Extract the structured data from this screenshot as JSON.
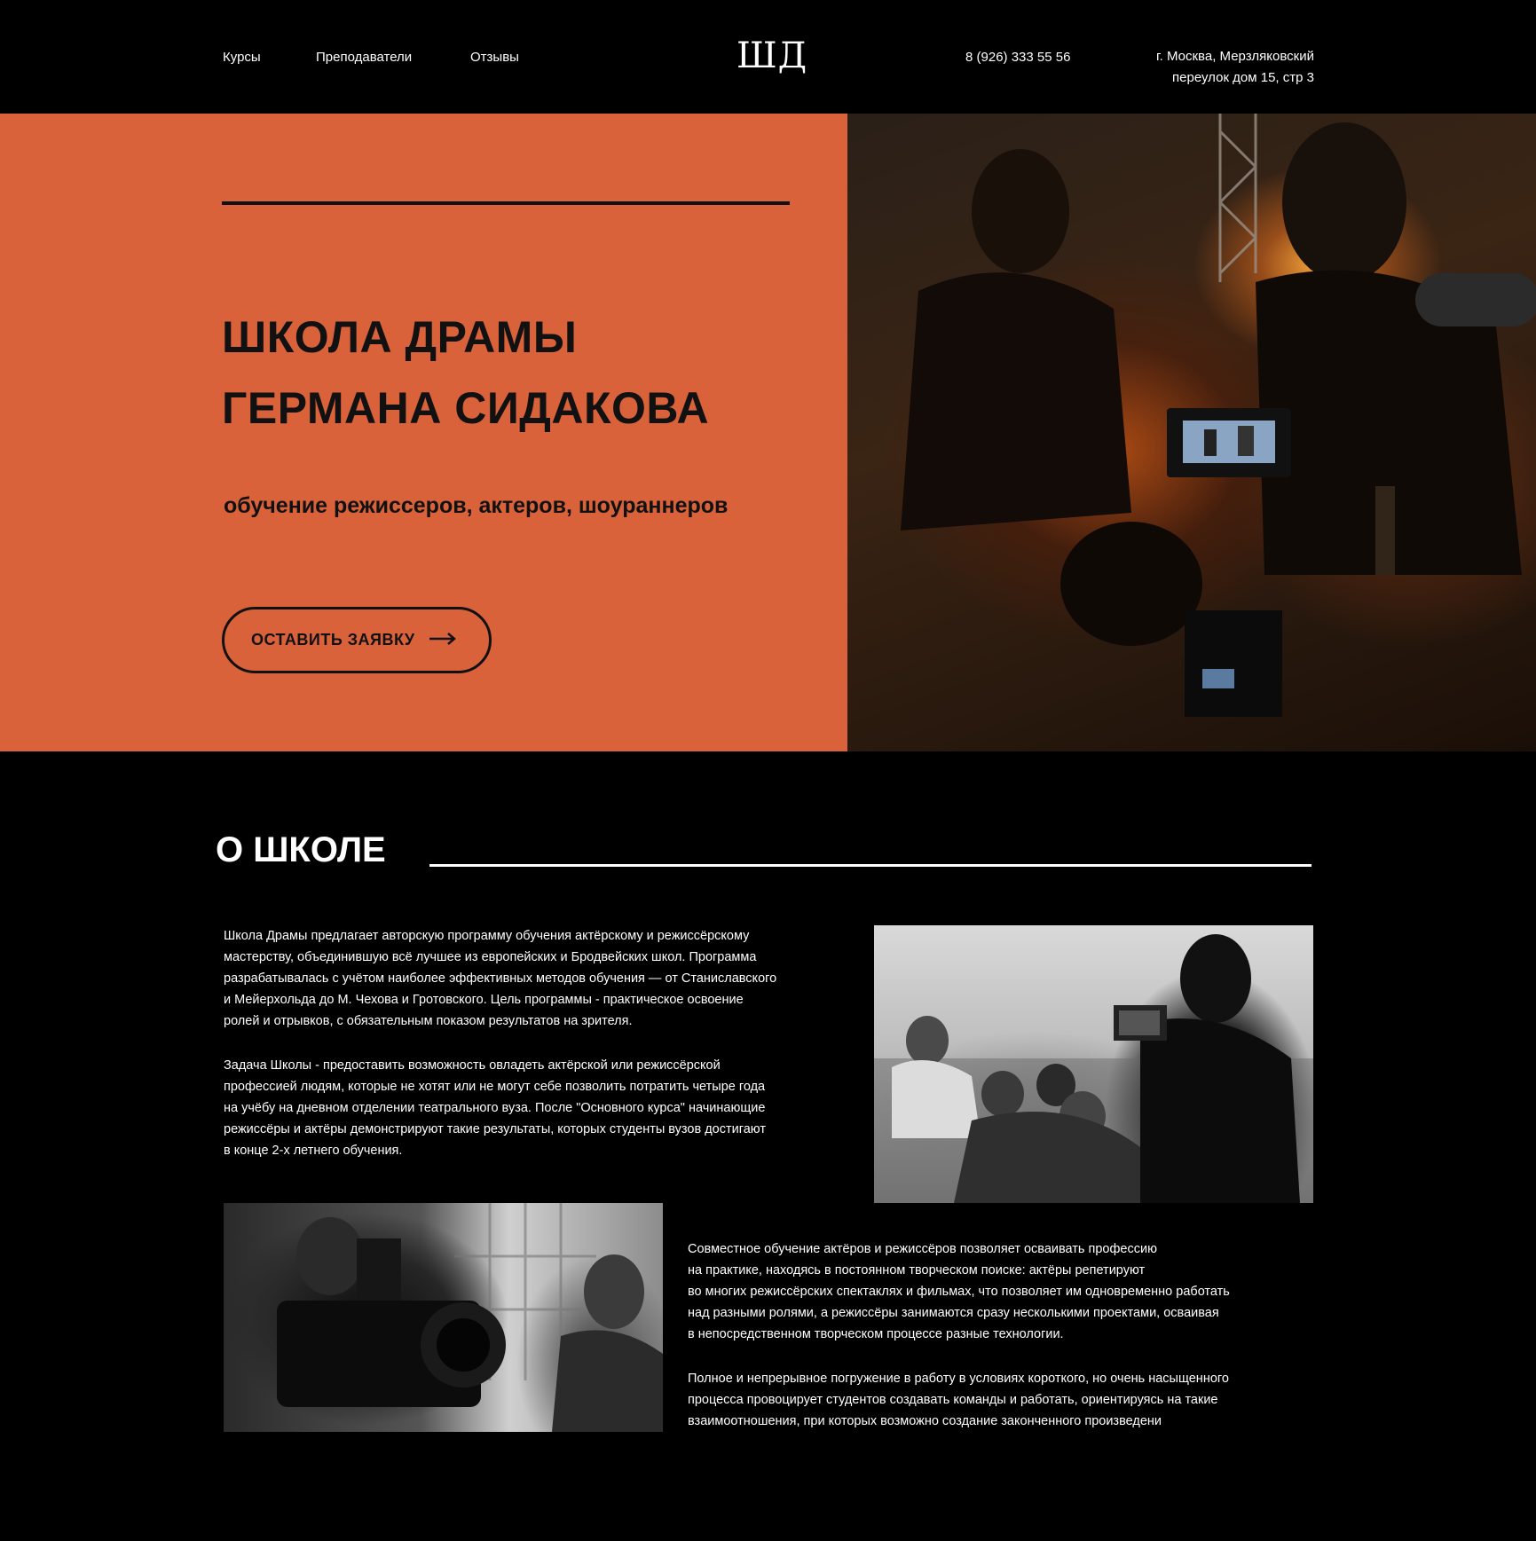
{
  "header": {
    "nav": [
      "Курсы",
      "Преподаватели",
      "Отзывы"
    ],
    "logo": "ШД",
    "phone": "8 (926) 333 55 56",
    "address_line1": "г. Москва, Мерзляковский",
    "address_line2": "переулок дом 15, стр 3"
  },
  "hero": {
    "title_line1": "ШКОЛА ДРАМЫ",
    "title_line2": "ГЕРМАНА СИДАКОВА",
    "subtitle": "обучение режиссеров, актеров, шоураннеров",
    "cta_label": "ОСТАВИТЬ ЗАЯВКУ",
    "accent_color": "#d9623b"
  },
  "about": {
    "title": "О ШКОЛЕ",
    "p1": "Школа Драмы предлагает авторскую программу обучения актёрскому и режиссёрскому\nмастерству, объединившую всё лучшее из европейских и Бродвейских школ. Программа\nразрабатывалась с учётом наиболее эффективных методов обучения — от Станиславского\nи Мейерхольда до М. Чехова и Гротовского. Цель программы - практическое освоение\nролей и отрывков, с обязательным показом результатов на зрителя.",
    "p2": "Задача Школы - предоставить возможность овладеть актёрской или режиссёрской\nпрофессией людям, которые не хотят или не могут себе позволить потратить четыре года\nна учёбу на дневном отделении театрального вуза. После \"Основного курса\" начинающие\nрежиссёры и актёры демонстрируют такие результаты, которых студенты вузов достигают\nв конце 2-х летнего обучения.",
    "p3": "Совместное обучение актёров и режиссёров позволяет осваивать профессию\nна практике, находясь в постоянном творческом поиске: актёры репетируют\nво многих режиссёрских спектаклях и фильмах, что позволяет им одновременно работать\nнад разными ролями, а режиссёры занимаются сразу несколькими проектами, осваивая\nв непосредственном творческом процессе разные технологии.",
    "p4": "Полное и непрерывное погружение в работу в условиях короткого, но очень насыщенного\nпроцесса провоцирует студентов создавать команды и работать, ориентируясь на такие\nвзаимоотношения, при которых возможно создание законченного произведени"
  }
}
